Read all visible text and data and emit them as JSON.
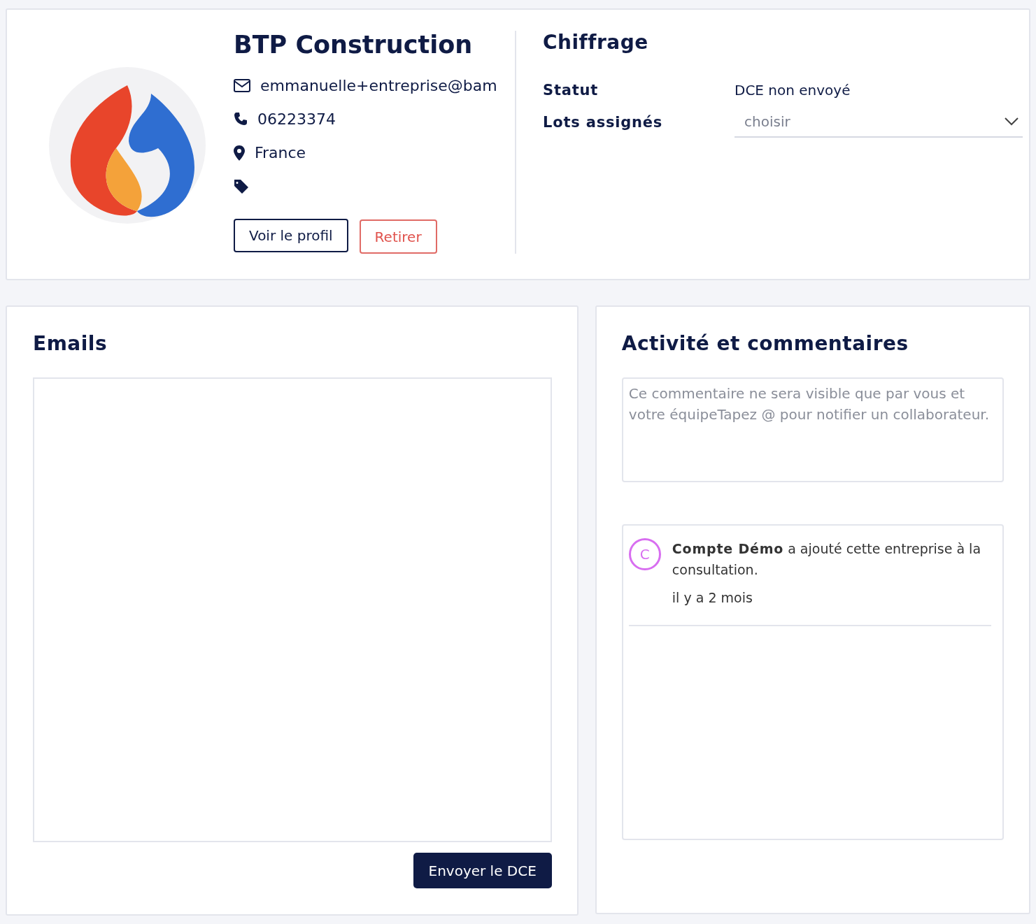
{
  "company": {
    "name": "BTP Construction",
    "email": "emmanuelle+entreprise@bam",
    "phone": "06223374",
    "country": "France",
    "buttons": [
      {
        "kind": "outline",
        "label": "Voir le profil"
      },
      {
        "kind": "danger",
        "label": "Retirer"
      }
    ]
  },
  "pricing": {
    "title": "Chiffrage",
    "fields": [
      {
        "kind": "text",
        "label": "Statut",
        "value": "DCE non envoyé"
      },
      {
        "kind": "select",
        "label": "Lots assignés",
        "placeholder": "choisir"
      }
    ]
  },
  "emails": {
    "title": "Emails",
    "button": "Envoyer le DCE"
  },
  "activity": {
    "title": "Activité et commentaires",
    "comment": {
      "placeholder": "Ce commentaire ne sera visible que par vous et votre équipeTapez @ pour notifier un collaborateur."
    },
    "events": [
      {
        "avatar": "C",
        "color": "#d86ef0",
        "text": "**Compte Démo** a ajouté cette entreprise à la consultation.",
        "time": "il y a 2 mois"
      }
    ]
  }
}
